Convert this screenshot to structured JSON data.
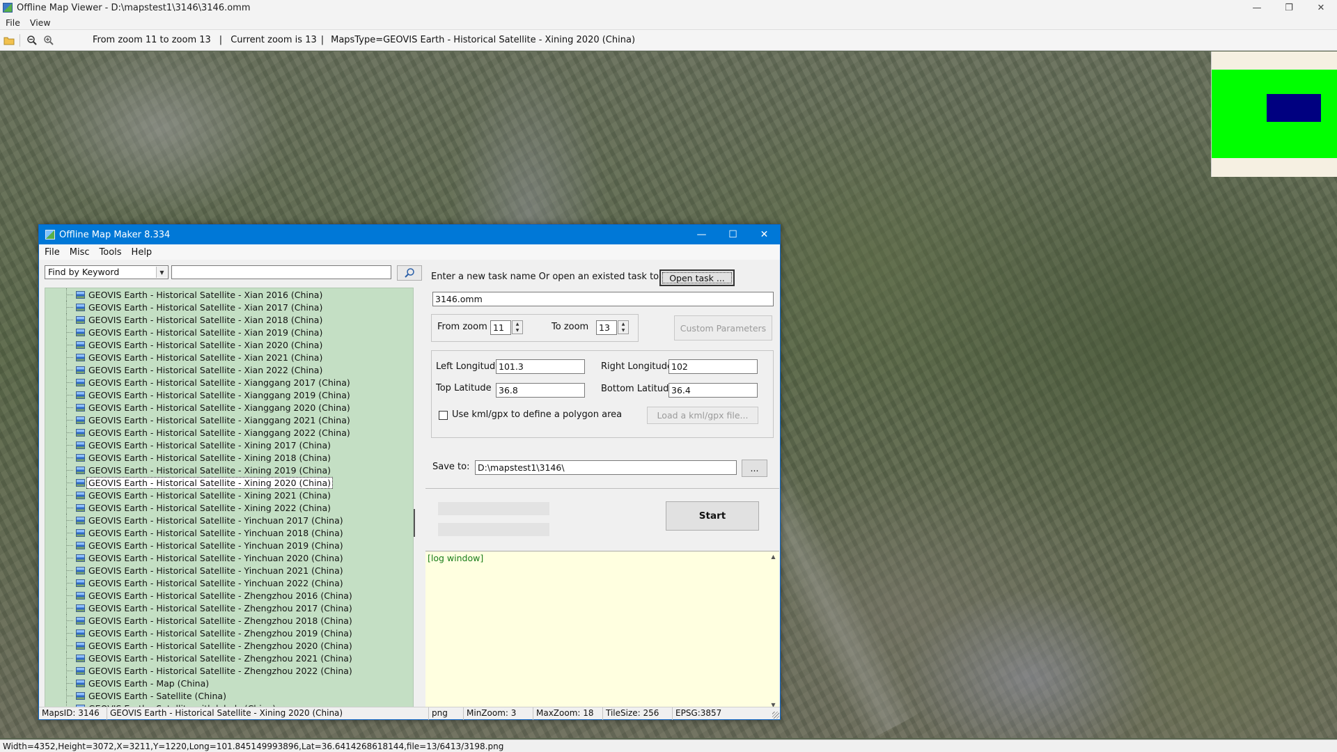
{
  "viewer": {
    "title": "Offline Map Viewer - D:\\mapstest1\\3146\\3146.omm",
    "menu": [
      "File",
      "View"
    ],
    "toolbar": {
      "zoom_range": "From zoom 11 to zoom 13",
      "separator": "|",
      "current_zoom": "Current zoom is 13",
      "maps_type": "MapsType=GEOVIS Earth - Historical Satellite - Xining 2020 (China)"
    },
    "status": "Width=4352,Height=3072,X=3211,Y=1220,Long=101.845149993896,Lat=36.6414268618144,file=13/6413/3198.png"
  },
  "dialog": {
    "title": "Offline Map Maker 8.334",
    "menu": [
      "File",
      "Misc",
      "Tools",
      "Help"
    ],
    "search": {
      "mode": "Find by Keyword",
      "query": ""
    },
    "maps_list": [
      "GEOVIS Earth - Historical Satellite - Xian 2016 (China)",
      "GEOVIS Earth - Historical Satellite - Xian 2017 (China)",
      "GEOVIS Earth - Historical Satellite - Xian 2018 (China)",
      "GEOVIS Earth - Historical Satellite - Xian 2019 (China)",
      "GEOVIS Earth - Historical Satellite - Xian 2020 (China)",
      "GEOVIS Earth - Historical Satellite - Xian 2021 (China)",
      "GEOVIS Earth - Historical Satellite - Xian 2022 (China)",
      "GEOVIS Earth - Historical Satellite - Xianggang 2017 (China)",
      "GEOVIS Earth - Historical Satellite - Xianggang 2019 (China)",
      "GEOVIS Earth - Historical Satellite - Xianggang 2020 (China)",
      "GEOVIS Earth - Historical Satellite - Xianggang 2021 (China)",
      "GEOVIS Earth - Historical Satellite - Xianggang 2022 (China)",
      "GEOVIS Earth - Historical Satellite - Xining 2017 (China)",
      "GEOVIS Earth - Historical Satellite - Xining 2018 (China)",
      "GEOVIS Earth - Historical Satellite - Xining 2019 (China)",
      "GEOVIS Earth - Historical Satellite - Xining 2020 (China)",
      "GEOVIS Earth - Historical Satellite - Xining 2021 (China)",
      "GEOVIS Earth - Historical Satellite - Xining 2022 (China)",
      "GEOVIS Earth - Historical Satellite - Yinchuan 2017 (China)",
      "GEOVIS Earth - Historical Satellite - Yinchuan 2018 (China)",
      "GEOVIS Earth - Historical Satellite - Yinchuan 2019 (China)",
      "GEOVIS Earth - Historical Satellite - Yinchuan 2020 (China)",
      "GEOVIS Earth - Historical Satellite - Yinchuan 2021 (China)",
      "GEOVIS Earth - Historical Satellite - Yinchuan 2022 (China)",
      "GEOVIS Earth - Historical Satellite - Zhengzhou 2016 (China)",
      "GEOVIS Earth - Historical Satellite - Zhengzhou 2017 (China)",
      "GEOVIS Earth - Historical Satellite - Zhengzhou 2018 (China)",
      "GEOVIS Earth - Historical Satellite - Zhengzhou 2019 (China)",
      "GEOVIS Earth - Historical Satellite - Zhengzhou 2020 (China)",
      "GEOVIS Earth - Historical Satellite - Zhengzhou 2021 (China)",
      "GEOVIS Earth - Historical Satellite - Zhengzhou 2022 (China)",
      "GEOVIS Earth - Map (China)",
      "GEOVIS Earth - Satellite (China)",
      "GEOVIS Earth - Satellite with labels (China)"
    ],
    "selected_map": "GEOVIS Earth - Historical Satellite - Xining 2020 (China)",
    "task": {
      "prompt": "Enter a new task name Or open an existed task to continue:",
      "open_button": "Open task ...",
      "name": "3146.omm"
    },
    "zoom": {
      "from_label": "From zoom",
      "from_value": "11",
      "to_label": "To zoom",
      "to_value": "13",
      "custom_button": "Custom Parameters"
    },
    "bounds": {
      "left_lon_label": "Left Longitude",
      "left_lon": "101.3",
      "right_lon_label": "Right Longitude",
      "right_lon": "102",
      "top_lat_label": "Top Latitude",
      "top_lat": "36.8",
      "bottom_lat_label": "Bottom Latitude",
      "bottom_lat": "36.4",
      "kml_label": "Use kml/gpx to define a polygon area",
      "kml_checked": false,
      "kml_button": "Load a kml/gpx file..."
    },
    "save": {
      "label": "Save to:",
      "path": "D:\\mapstest1\\3146\\",
      "browse_button": "..."
    },
    "start_button": "Start",
    "log_label": "[log window]",
    "status": {
      "maps_id": "MapsID: 3146",
      "map_name": "GEOVIS Earth - Historical Satellite - Xining 2020 (China)",
      "format": "png",
      "min_zoom": "MinZoom: 3",
      "max_zoom": "MaxZoom: 18",
      "tile_size": "TileSize: 256",
      "epsg": "EPSG:3857"
    }
  },
  "colors": {
    "dialog_titlebar": "#0078d7",
    "tree_background": "#c4dfc4",
    "log_background": "#ffffe0",
    "overview_area": "#00ff00",
    "overview_viewport": "#000080"
  }
}
